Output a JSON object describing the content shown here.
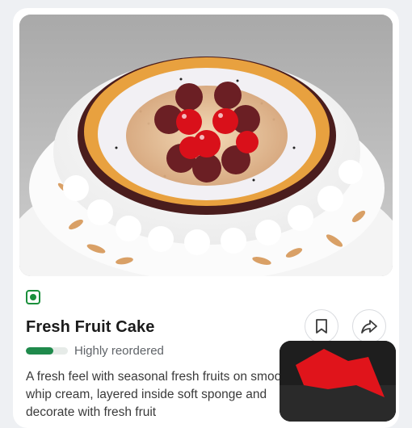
{
  "product": {
    "name": "Fresh Fruit Cake",
    "popularity_label": "Highly reordered",
    "popularity_level": 0.65,
    "description": "A fresh feel with seasonal fresh fruits on smooth whip cream, layered inside soft sponge and decorate with fresh fruit",
    "diet_mark": "veg-icon"
  },
  "actions": {
    "bookmark_icon": "bookmark-icon",
    "share_icon": "share-icon"
  },
  "colors": {
    "accent_green": "#1a8f3c",
    "popularity_fill": "#1f8a4c"
  }
}
